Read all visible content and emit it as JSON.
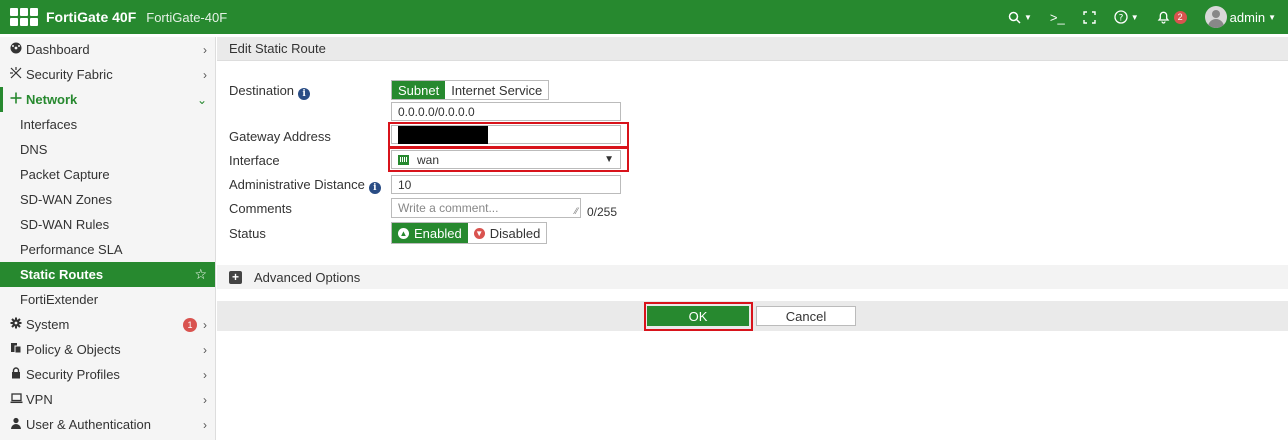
{
  "topbar": {
    "brand": "FortiGate 40F",
    "hostname": "FortiGate-40F",
    "cli_glyph": ">_",
    "notification_count": "2",
    "user": "admin"
  },
  "sidebar": {
    "items": [
      {
        "label": "Dashboard",
        "icon": "dashboard-icon"
      },
      {
        "label": "Security Fabric",
        "icon": "security-fabric-icon"
      },
      {
        "label": "Network",
        "icon": "network-icon"
      }
    ],
    "network_sub": [
      "Interfaces",
      "DNS",
      "Packet Capture",
      "SD-WAN Zones",
      "SD-WAN Rules",
      "Performance SLA",
      "Static Routes",
      "FortiExtender"
    ],
    "bottom_items": [
      {
        "label": "System",
        "icon": "gear-icon"
      },
      {
        "label": "Policy & Objects",
        "icon": "policy-icon"
      },
      {
        "label": "Security Profiles",
        "icon": "lock-icon"
      },
      {
        "label": "VPN",
        "icon": "laptop-icon"
      },
      {
        "label": "User & Authentication",
        "icon": "user-icon"
      }
    ],
    "system_badge": "1"
  },
  "page": {
    "title": "Edit Static Route"
  },
  "form": {
    "destination_label": "Destination",
    "dest_subnet": "Subnet",
    "dest_internet_service": "Internet Service",
    "dest_value": "0.0.0.0/0.0.0.0",
    "gateway_label": "Gateway Address",
    "interface_label": "Interface",
    "interface_value": "wan",
    "admin_distance_label": "Administrative Distance",
    "admin_distance_value": "10",
    "comments_label": "Comments",
    "comments_placeholder": "Write a comment...",
    "comments_counter": "0/255",
    "status_label": "Status",
    "status_enabled": "Enabled",
    "status_disabled": "Disabled",
    "advanced_options": "Advanced Options"
  },
  "footer": {
    "ok": "OK",
    "cancel": "Cancel"
  },
  "colors": {
    "brand_green": "#27892f",
    "highlight_red": "#d8131b",
    "badge_red": "#d9534f"
  }
}
